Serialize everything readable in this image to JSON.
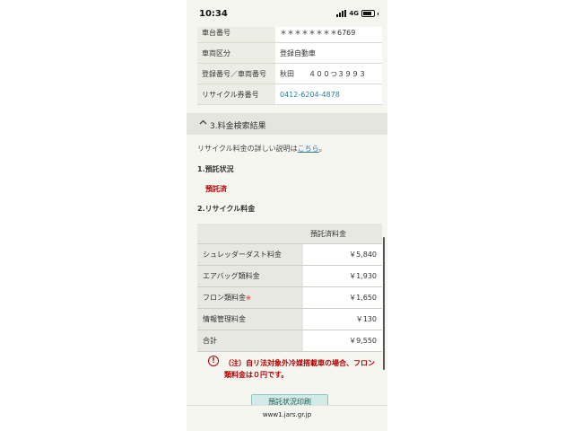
{
  "status": {
    "time": "10:34",
    "network": "4G"
  },
  "vehicle_rows": [
    {
      "label": "車台番号",
      "value": "＊＊＊＊＊＊＊＊6769"
    },
    {
      "label": "車両区分",
      "value": "登録自動車"
    },
    {
      "label": "登録番号／車両番号",
      "value": "秋田　　４００つ３９９３"
    },
    {
      "label": "リサイクル券番号",
      "value": "0412-6204-4878"
    }
  ],
  "section": {
    "title": "3.料金検索結果"
  },
  "explain": {
    "prefix": "リサイクル料金の詳しい説明は",
    "link": "こちら",
    "suffix": "。"
  },
  "deposit": {
    "heading": "1.預託状況",
    "status": "預託済"
  },
  "fees": {
    "heading": "2.リサイクル料金",
    "column_header": "預託済料金",
    "rows": [
      {
        "name": "シュレッダーダスト料金",
        "amount": "￥5,840"
      },
      {
        "name": "エアバッグ類料金",
        "amount": "￥1,930"
      },
      {
        "name": "フロン類料金",
        "mark": "※",
        "amount": "￥1,650"
      },
      {
        "name": "情報管理料金",
        "amount": "￥130"
      },
      {
        "name": "合計",
        "amount": "￥9,550"
      }
    ]
  },
  "notice": {
    "icon": "!",
    "text": "（注）自リ法対象外冷媒搭載車の場合、フロン類料金は０円です。"
  },
  "print_button": {
    "label": "預託状況印刷"
  },
  "browser": {
    "url": "www1.jars.gr.jp"
  },
  "colors": {
    "accent_link": "#2a7fa0",
    "alert_red": "#b40000",
    "button_bg": "#d3ebe8"
  }
}
